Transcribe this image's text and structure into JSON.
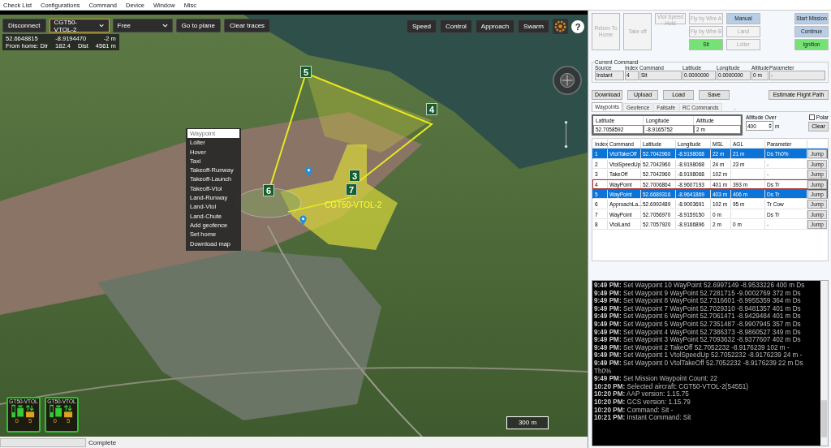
{
  "menu": [
    "Check List",
    "Configurations",
    "Command",
    "Device",
    "Window",
    "Misc"
  ],
  "map_toolbar": {
    "left": [
      {
        "kind": "button",
        "label": "Disconnect"
      },
      {
        "kind": "select",
        "label": "CGT50-VTOL-2",
        "focused": true
      },
      {
        "kind": "select",
        "label": "Free",
        "focused": false
      },
      {
        "kind": "button",
        "label": "Go to plane"
      },
      {
        "kind": "button",
        "label": "Clear traces"
      }
    ],
    "right": [
      "Speed",
      "Control",
      "Approach",
      "Swarm"
    ],
    "help_glyph": "?"
  },
  "position": {
    "latitude": "52.6648815",
    "longitude": "-8.9194470",
    "altitude": "-2 m",
    "from_home": "From home: Dir",
    "dir": "182.4",
    "dist_label": "Dist",
    "dist": "4561 m"
  },
  "map": {
    "markers": [
      {
        "label": "5"
      },
      {
        "label": "4"
      },
      {
        "label": "3"
      },
      {
        "label": "6"
      },
      {
        "label": "7"
      }
    ],
    "aircraft_label": "CGT50-VTOL-2",
    "scale": "300 m"
  },
  "context_menu": [
    {
      "label": "Waypoint",
      "selected": true
    },
    {
      "label": "Loiter",
      "selected": false
    },
    {
      "label": "Hover",
      "selected": false
    },
    {
      "label": "Taxi",
      "selected": false
    },
    {
      "label": "Takeoff-Runway",
      "selected": false
    },
    {
      "label": "Takeoff-Launch",
      "selected": false
    },
    {
      "label": "Takeoff-Vtol",
      "selected": false
    },
    {
      "label": "Land-Runway",
      "selected": false
    },
    {
      "label": "Land-Vtol",
      "selected": false
    },
    {
      "label": "Land-Chute",
      "selected": false
    },
    {
      "label": "Add geofence",
      "selected": false
    },
    {
      "label": "Set home",
      "selected": false
    },
    {
      "label": "Download map",
      "selected": false
    }
  ],
  "aircraft_cards": [
    {
      "name": "GT50-VTOL",
      "fuel": "0",
      "power": "5"
    },
    {
      "name": "GT50-VTOL",
      "fuel": "0",
      "power": "5"
    }
  ],
  "status_bar": {
    "level": 0,
    "text": "Complete"
  },
  "mode_buttons": [
    {
      "label": "Return To Home",
      "kind": "disabled"
    },
    {
      "label": "Take off",
      "kind": "disabled"
    },
    {
      "label": "Vtol Speed Hold",
      "kind": "disabled"
    },
    {
      "label": "Fly by Wire A",
      "kind": "disabled"
    },
    {
      "label": "Fly by Wire B",
      "kind": "disabled"
    },
    {
      "label": "Sit",
      "kind": "green"
    },
    {
      "label": "Manual",
      "kind": "blue"
    },
    {
      "label": "Land",
      "kind": "disabled"
    },
    {
      "label": "Loiter",
      "kind": "disabled"
    },
    {
      "label": "Start Mission",
      "kind": "blue"
    },
    {
      "label": "Continue",
      "kind": "blue"
    },
    {
      "label": "Ignition",
      "kind": "green"
    }
  ],
  "current_command": {
    "title": "Current Command",
    "columns": [
      "Source",
      "Index",
      "Command",
      "Latitude",
      "Longitude",
      "Altitude",
      "Parameter"
    ],
    "values": [
      "Instant",
      "4",
      "Sit",
      "0.0000000",
      "0.0000000",
      "0 m",
      "-"
    ]
  },
  "mission_buttons": [
    "Download",
    "Upload",
    "Load",
    "Save"
  ],
  "estimate_button": "Estimate Flight Path",
  "tabs": [
    {
      "label": "Waypoints",
      "selected": true
    },
    {
      "label": "Geofence",
      "selected": false
    },
    {
      "label": "Failsafe",
      "selected": false
    },
    {
      "label": "RC Commands",
      "selected": false
    }
  ],
  "tab_strip_mark": "-",
  "waypoint_edit": {
    "columns": [
      "Latitude",
      "Longitude",
      "Altitude"
    ],
    "values": [
      "52.7058592",
      "-8.9165752",
      "2 m"
    ],
    "altitude_over_label": "Altitude Over",
    "altitude_over": "400",
    "unit": "m",
    "polar": {
      "label": "Polar",
      "checked": false
    },
    "clear": "Clear"
  },
  "waypoints": {
    "columns": [
      "Index",
      "Command",
      "Latitude",
      "Longitude",
      "MSL",
      "AGL",
      "Parameter"
    ],
    "rows": [
      {
        "cells": [
          "1",
          "VtolTakeOff",
          "52.7042960",
          "-8.9198068",
          "22 m",
          "21 m",
          "Ds Th0%"
        ],
        "jump": "Jump",
        "selected": true,
        "current": false
      },
      {
        "cells": [
          "2",
          "VtolSpeedUp",
          "52.7042960",
          "-8.9198068",
          "24 m",
          "23 m",
          "-"
        ],
        "jump": "Jump",
        "selected": false,
        "current": false
      },
      {
        "cells": [
          "3",
          "TakeOff",
          "52.7042960",
          "-8.9198068",
          "102 m",
          "",
          "-"
        ],
        "jump": "Jump",
        "selected": false,
        "current": false
      },
      {
        "cells": [
          "4",
          "WayPoint",
          "52.7006864",
          "-8.9607193",
          "401 m",
          "393 m",
          "Ds Tr"
        ],
        "jump": "Jump",
        "selected": false,
        "current": true
      },
      {
        "cells": [
          "5",
          "WayPoint",
          "52.6689316",
          "-8.9641869",
          "403 m",
          "406 m",
          "Ds Tr"
        ],
        "jump": "Jump",
        "selected": true,
        "current": false
      },
      {
        "cells": [
          "6",
          "ApproachLa...",
          "52.6992489",
          "-8.9003691",
          "102 m",
          "95 m",
          "Tr Cow"
        ],
        "jump": "Jump",
        "selected": false,
        "current": false
      },
      {
        "cells": [
          "7",
          "WayPoint",
          "52.7056970",
          "-8.9159150",
          "0 m",
          "",
          "Ds Tr"
        ],
        "jump": "Jump",
        "selected": false,
        "current": false
      },
      {
        "cells": [
          "8",
          "VtolLand",
          "52.7057920",
          "-8.9166896",
          "2 m",
          "0 m",
          "-"
        ],
        "jump": "Jump",
        "selected": false,
        "current": false
      }
    ]
  },
  "log": [
    {
      "time": "9:49 PM:",
      "text": "Set Waypoint 10 WayPoint 52.6997149 -8.9533226 400 m Ds"
    },
    {
      "time": "9:49 PM:",
      "text": "Set Waypoint 9 WayPoint 52.7281715 -9.0002769 372 m Ds"
    },
    {
      "time": "9:49 PM:",
      "text": "Set Waypoint 8 WayPoint 52.7316601 -8.9955359 364 m Ds"
    },
    {
      "time": "9:49 PM:",
      "text": "Set Waypoint 7 WayPoint 52.7029310 -8.9481357 401 m Ds"
    },
    {
      "time": "9:49 PM:",
      "text": "Set Waypoint 6 WayPoint 52.7061471 -8.9429484 401 m Ds"
    },
    {
      "time": "9:49 PM:",
      "text": "Set Waypoint 5 WayPoint 52.7351487 -8.9907945 357 m Ds"
    },
    {
      "time": "9:49 PM:",
      "text": "Set Waypoint 4 WayPoint 52.7386373 -8.9860527 349 m Ds"
    },
    {
      "time": "9:49 PM:",
      "text": "Set Waypoint 3 WayPoint 52.7093632 -8.9377607 402 m Ds"
    },
    {
      "time": "9:49 PM:",
      "text": "Set Waypoint 2 TakeOff 52.7052232 -8.9176239 102 m -"
    },
    {
      "time": "9:49 PM:",
      "text": "Set Waypoint 1 VtolSpeedUp 52.7052232 -8.9176239 24 m -"
    },
    {
      "time": "9:49 PM:",
      "text": "Set Waypoint 0 VtolTakeOff 52.7052232 -8.9176239 22 m Ds Th0%"
    },
    {
      "time": "9:49 PM:",
      "text": "Set Mission Waypoint Count: 22"
    },
    {
      "time": "10:20 PM:",
      "text": "Selected aircraft: CGT50-VTOL-2(54551)"
    },
    {
      "time": "10:20 PM:",
      "text": "AAP version: 1.15.75"
    },
    {
      "time": "10:20 PM:",
      "text": "GCS version: 1.15.79"
    },
    {
      "time": "10:20 PM:",
      "text": "Command: Sit -"
    },
    {
      "time": "10:21 PM:",
      "text": "Instant Command: Sit"
    }
  ]
}
